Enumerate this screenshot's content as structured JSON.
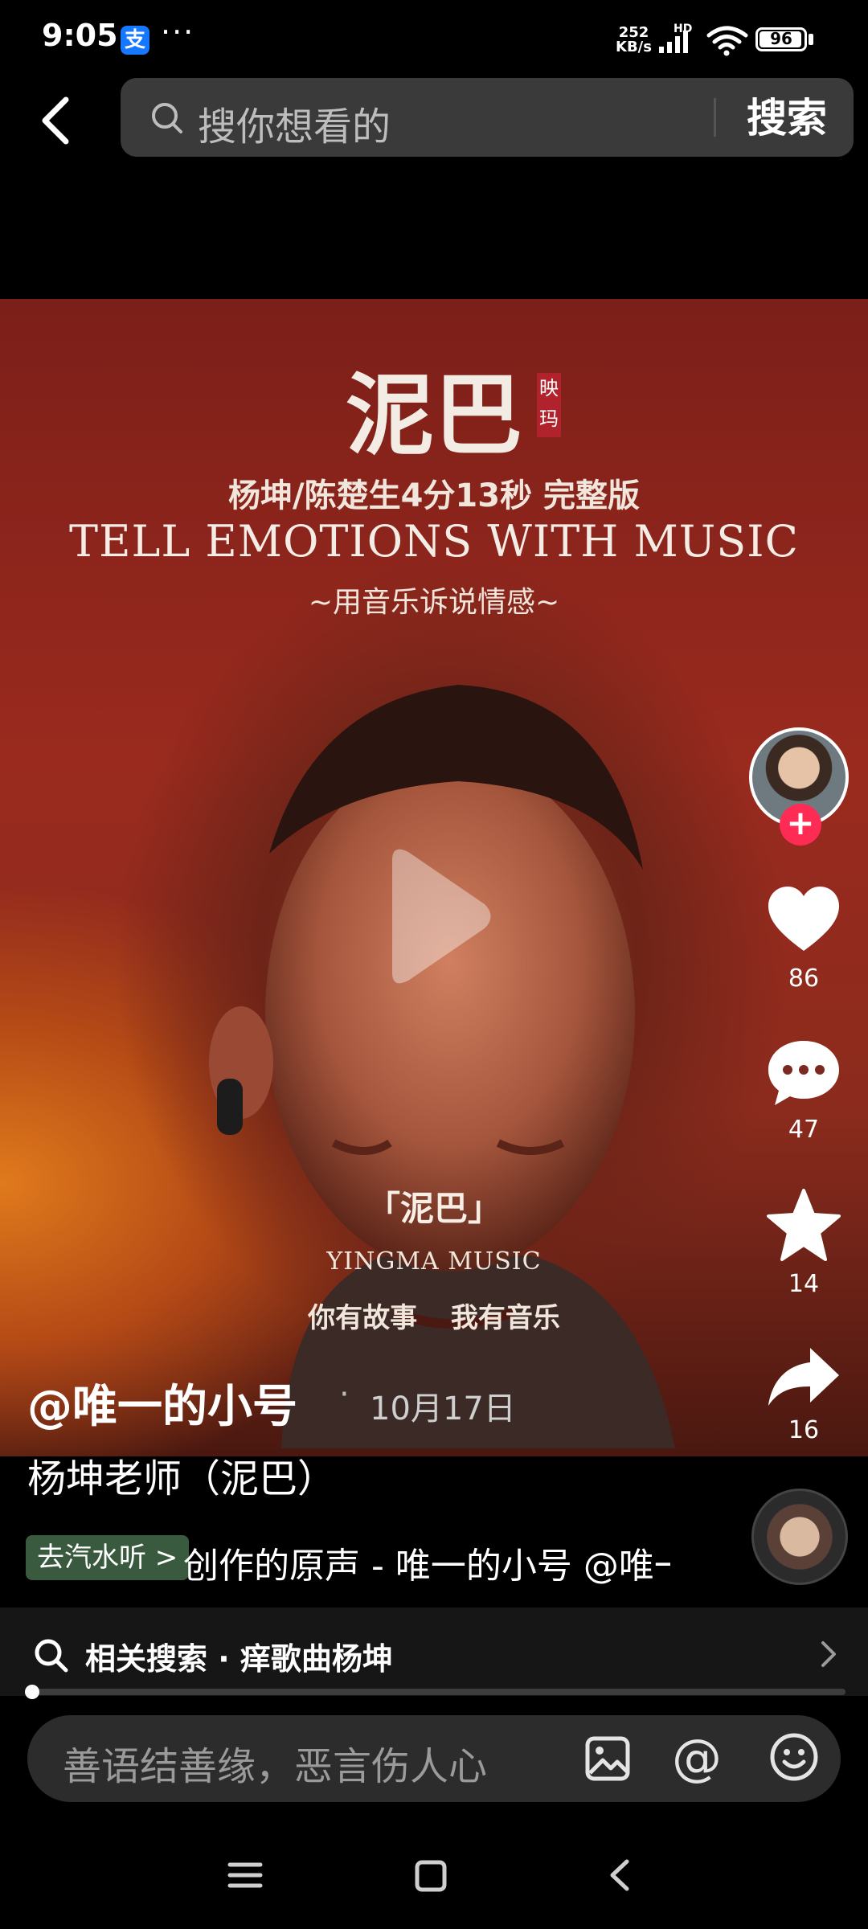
{
  "status_bar": {
    "time": "9:05",
    "alipay_icon_label": "支",
    "more": "···",
    "net_speed_value": "252",
    "net_speed_unit": "KB/s",
    "hd_label": "HD",
    "battery": "96",
    "battery_level": 0.96
  },
  "header": {
    "search_placeholder": "搜你想看的",
    "search_button": "搜索"
  },
  "video": {
    "title": "泥巴",
    "seal": "映玛",
    "subtitle_line1": "杨坤/陈楚生4分13秒 完整版",
    "subtitle_line2": "TELL EMOTIONS WITH MUSIC",
    "subtitle_line3": "~用音乐诉说情感~",
    "caption_song": "「泥巴」",
    "caption_label": "YINGMA MUSIC",
    "caption_slogan": "你有故事 我有音乐"
  },
  "rail": {
    "likes": "86",
    "comments": "47",
    "favorites": "14",
    "shares": "16",
    "follow_symbol": "+"
  },
  "post": {
    "author": "@唯一的小号",
    "separator": "·",
    "date": "10月17日",
    "caption": "杨坤老师（泥巴）",
    "music_chip": "去汽水听 >",
    "music_track": "创作的原声 - 唯一的小号    @唯一的小号"
  },
  "related": {
    "text": "相关搜索 · 痒歌曲杨坤"
  },
  "playback": {
    "progress": 0.006
  },
  "comment_bar": {
    "placeholder": "善语结善缘，恶言伤人心",
    "at_symbol": "@"
  },
  "colors": {
    "accent_red": "#fe2c55",
    "chip_green": "#3a5a3f",
    "alipay_blue": "#1677ff"
  },
  "icons": {
    "back": "chevron-left-icon",
    "search": "search-icon",
    "play": "play-icon",
    "like": "heart-icon",
    "comment": "speech-bubble-icon",
    "favorite": "star-icon",
    "share": "share-arrow-icon",
    "image": "image-icon",
    "emoji": "smiley-icon"
  }
}
